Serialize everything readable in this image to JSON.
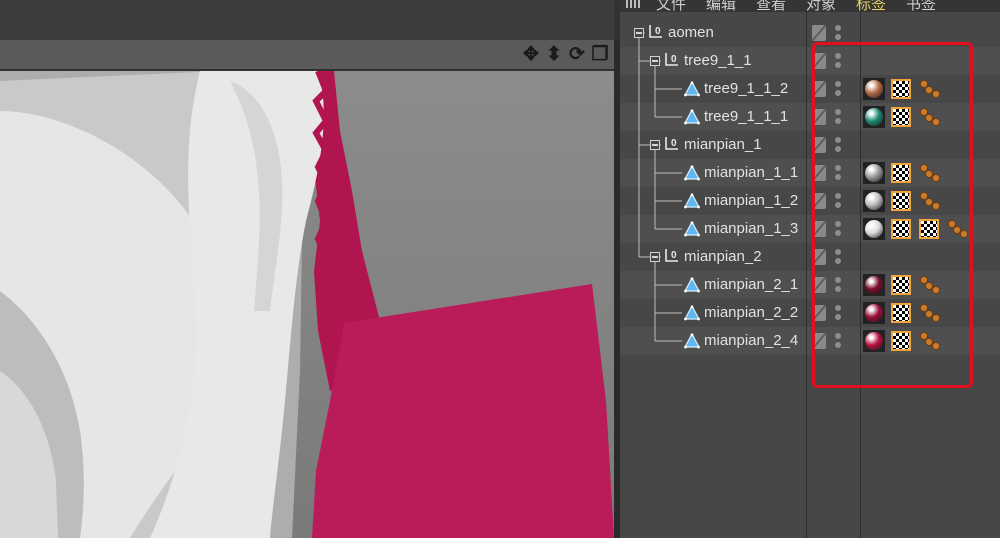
{
  "menubar": {
    "items": [
      {
        "label": "文件",
        "active": false
      },
      {
        "label": "编辑",
        "active": false
      },
      {
        "label": "查看",
        "active": false
      },
      {
        "label": "对象",
        "active": false
      },
      {
        "label": "标签",
        "active": true
      },
      {
        "label": "书签",
        "active": false
      }
    ]
  },
  "viewport": {
    "nav_icons": [
      "move-view-icon",
      "zoom-view-icon",
      "rotate-view-icon",
      "maximize-view-icon"
    ]
  },
  "objects": [
    {
      "name": "aomen",
      "type": "null",
      "level": 0,
      "expandable": true,
      "material": null,
      "tags": []
    },
    {
      "name": "tree9_1_1",
      "type": "null",
      "level": 1,
      "expandable": true,
      "material": null,
      "tags": []
    },
    {
      "name": "tree9_1_1_2",
      "type": "polygon",
      "level": 2,
      "expandable": false,
      "material": "#b36a48",
      "tags": [
        "texture",
        "selection"
      ]
    },
    {
      "name": "tree9_1_1_1",
      "type": "polygon",
      "level": 2,
      "expandable": false,
      "material": "#1f8a73",
      "tags": [
        "texture",
        "selection"
      ]
    },
    {
      "name": "mianpian_1",
      "type": "null",
      "level": 1,
      "expandable": true,
      "material": null,
      "tags": []
    },
    {
      "name": "mianpian_1_1",
      "type": "polygon",
      "level": 2,
      "expandable": false,
      "material": "#9a9a9a",
      "tags": [
        "texture",
        "selection"
      ]
    },
    {
      "name": "mianpian_1_2",
      "type": "polygon",
      "level": 2,
      "expandable": false,
      "material": "#bcbcbc",
      "tags": [
        "texture",
        "selection"
      ]
    },
    {
      "name": "mianpian_1_3",
      "type": "polygon",
      "level": 2,
      "expandable": false,
      "material": "#dcdcdc",
      "tags": [
        "texture",
        "texture",
        "selection"
      ]
    },
    {
      "name": "mianpian_2",
      "type": "null",
      "level": 1,
      "expandable": true,
      "material": null,
      "tags": []
    },
    {
      "name": "mianpian_2_1",
      "type": "polygon",
      "level": 2,
      "expandable": false,
      "material": "#7a0d2c",
      "tags": [
        "texture",
        "selection"
      ]
    },
    {
      "name": "mianpian_2_2",
      "type": "polygon",
      "level": 2,
      "expandable": false,
      "material": "#9c0f3a",
      "tags": [
        "texture",
        "selection"
      ]
    },
    {
      "name": "mianpian_2_4",
      "type": "polygon",
      "level": 2,
      "expandable": false,
      "material": "#b8123f",
      "tags": [
        "texture",
        "selection"
      ]
    }
  ],
  "colors": {
    "accent_magenta": "#b91c58",
    "annotation": "#e2101e",
    "menu_active": "#e7cf6a"
  }
}
